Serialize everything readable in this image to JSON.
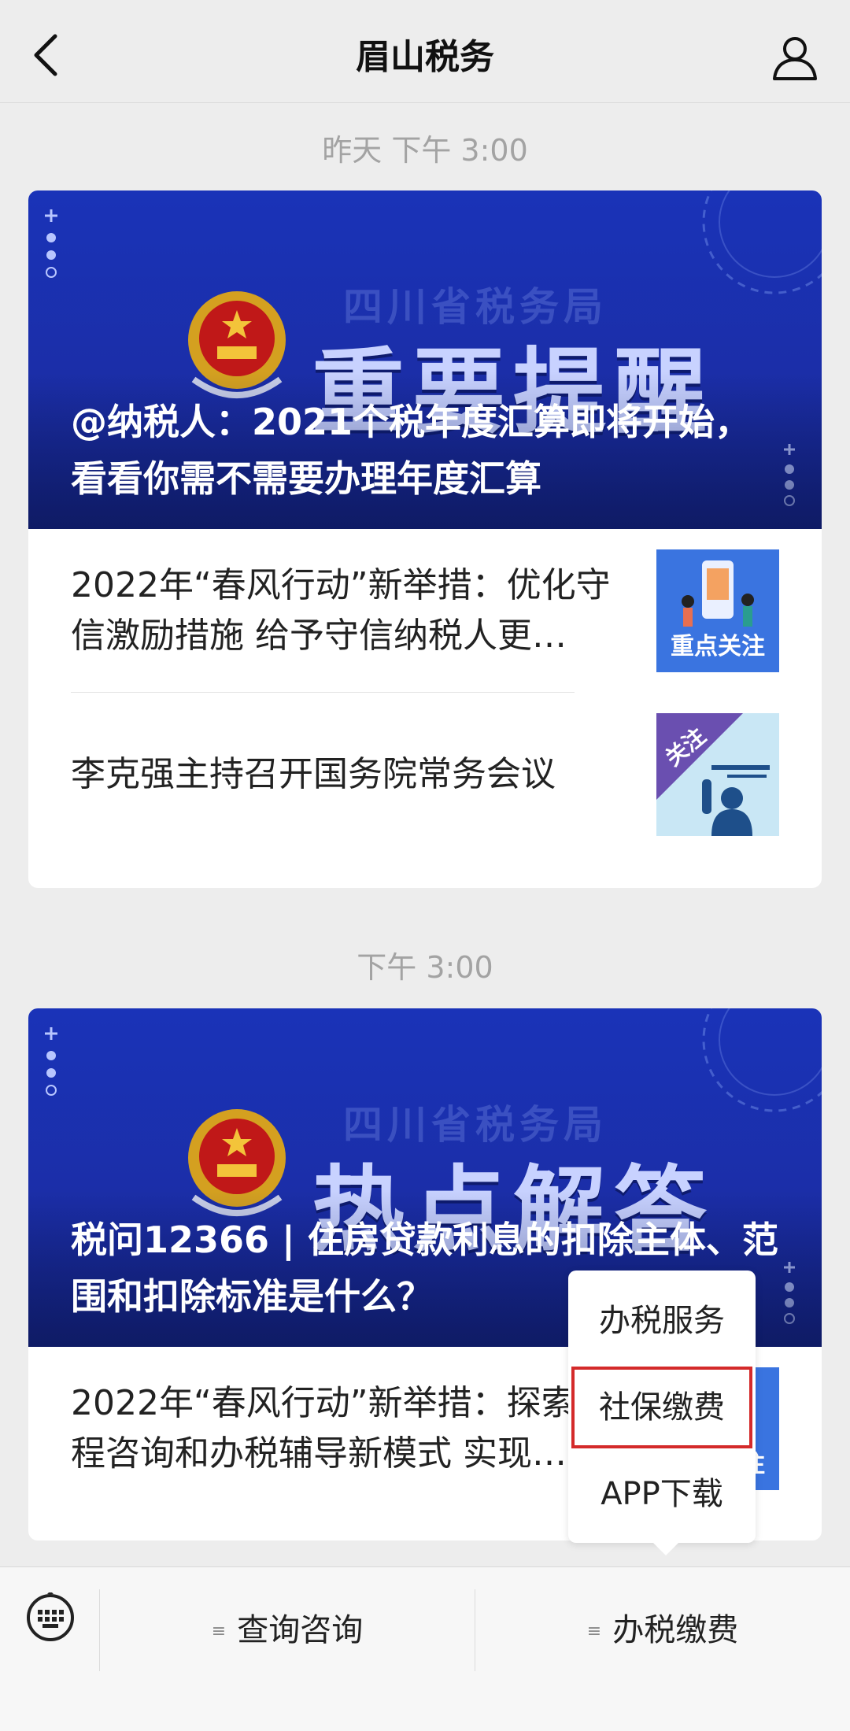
{
  "header": {
    "title": "眉山税务"
  },
  "messages": [
    {
      "timestamp": "昨天 下午 3:00",
      "banner": {
        "agency": "四川省税务局",
        "big_text": "重要提醒",
        "headline": "@纳税人：2021个税年度汇算即将开始，看看你需不需要办理年度汇算"
      },
      "items": [
        {
          "text": "2022年“春风行动”新举措：优化守信激励措施 给予守信纳税人更…",
          "thumb_text": "重点关注"
        },
        {
          "text": "李克强主持召开国务院常务会议",
          "thumb_text": "关注"
        }
      ]
    },
    {
      "timestamp": "下午 3:00",
      "banner": {
        "agency": "四川省税务局",
        "big_text": "热点解答",
        "headline": "税问12366 | 住房贷款利息的扣除主体、范围和扣除标准是什么？"
      },
      "items": [
        {
          "text": "2022年“春风行动”新举措：探索远程咨询和办税辅导新模式 实现…",
          "thumb_text": "重点关注"
        }
      ]
    }
  ],
  "popup_menu": {
    "items": [
      "办税服务",
      "社保缴费",
      "APP下载"
    ],
    "highlighted": "社保缴费",
    "highlight_color": "#d42a2a"
  },
  "bottom_menu": {
    "left_label": "查询咨询",
    "right_label": "办税缴费",
    "menu_glyph": "≡"
  },
  "icons": [
    "back-arrow-icon",
    "profile-icon",
    "keyboard-icon"
  ]
}
